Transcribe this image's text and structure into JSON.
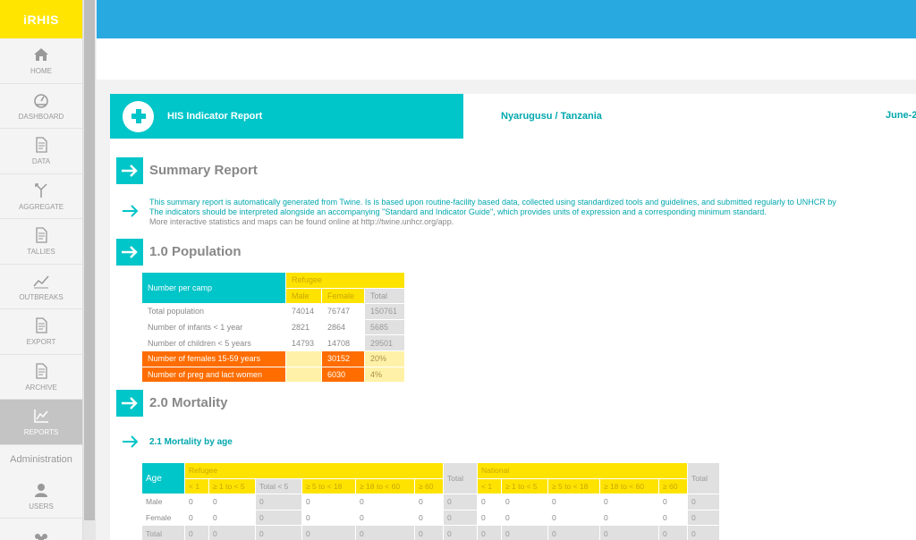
{
  "app": {
    "name": "iRHIS"
  },
  "sidebar": {
    "items": [
      {
        "label": "HOME",
        "icon": "home-icon"
      },
      {
        "label": "DASHBOARD",
        "icon": "dashboard-icon"
      },
      {
        "label": "DATA",
        "icon": "document-icon"
      },
      {
        "label": "AGGREGATE",
        "icon": "merge-icon"
      },
      {
        "label": "TALLIES",
        "icon": "document-icon"
      },
      {
        "label": "OUTBREAKS",
        "icon": "trend-icon"
      },
      {
        "label": "EXPORT",
        "icon": "document-icon"
      },
      {
        "label": "ARCHIVE",
        "icon": "document-icon"
      },
      {
        "label": "REPORTS",
        "icon": "chart-icon",
        "active": true
      }
    ],
    "admin_label": "Administration",
    "admin_items": [
      {
        "label": "USERS",
        "icon": "user-icon"
      }
    ]
  },
  "report": {
    "title": "HIS Indicator Report",
    "location": "Nyarugusu / Tanzania",
    "date": "June-2"
  },
  "summary": {
    "title": "Summary Report",
    "line1": "This summary report is automatically generated from Twine. Is is based upon routine-facility based data, collected using standardized tools and guidelines, and submitted regularly to UNHCR by",
    "line2": "The indicators should be interpreted alongside an accompanying \"Standard and Indicator Guide\", which provides units of expression and a corresponding minimum standard.",
    "line3": "More interactive statistics and maps can be found online at http://twine.unhcr.org/app."
  },
  "population": {
    "title": "1.0 Population",
    "header_label": "Number per camp",
    "group": "Refugee",
    "cols": [
      "Male",
      "Female",
      "Total"
    ],
    "rows": [
      {
        "label": "Total population",
        "male": "74014",
        "female": "76747",
        "total": "150761"
      },
      {
        "label": "Number of infants < 1 year",
        "male": "2821",
        "female": "2864",
        "total": "5685"
      },
      {
        "label": "Number of children < 5 years",
        "male": "14793",
        "female": "14708",
        "total": "29501"
      },
      {
        "label": "Number of females 15-59 years",
        "male": "",
        "female": "30152",
        "total": "20%"
      },
      {
        "label": "Number of preg and lact women",
        "male": "",
        "female": "6030",
        "total": "4%"
      }
    ]
  },
  "mortality": {
    "title": "2.0 Mortality",
    "sub_title": "2.1 Mortality by age",
    "age_label": "Age",
    "refugee_label": "Refugee",
    "national_label": "National",
    "total_label": "Total",
    "refugee_cols": [
      "< 1",
      "≥ 1 to < 5",
      "Total < 5",
      "≥ 5 to < 18",
      "≥ 18 to < 60",
      "≥ 60"
    ],
    "national_cols": [
      "< 1",
      "≥ 1 to < 5",
      "≥ 5 to < 18",
      "≥ 18 to < 60",
      "≥ 60"
    ],
    "rows": [
      {
        "label": "Male",
        "values": [
          "0",
          "0",
          "0",
          "0",
          "0",
          "0",
          "0",
          "0",
          "0",
          "0",
          "0",
          "0",
          "0"
        ]
      },
      {
        "label": "Female",
        "values": [
          "0",
          "0",
          "0",
          "0",
          "0",
          "0",
          "0",
          "0",
          "0",
          "0",
          "0",
          "0",
          "0"
        ]
      },
      {
        "label": "Total",
        "values": [
          "0",
          "0",
          "0",
          "0",
          "0",
          "0",
          "0",
          "0",
          "0",
          "0",
          "0",
          "0",
          "0"
        ]
      }
    ]
  },
  "colors": {
    "brand_yellow": "#ffe500",
    "top_blue": "#28a9e0",
    "accent_cyan": "#00c5c9",
    "highlight_orange": "#ff6d00"
  }
}
